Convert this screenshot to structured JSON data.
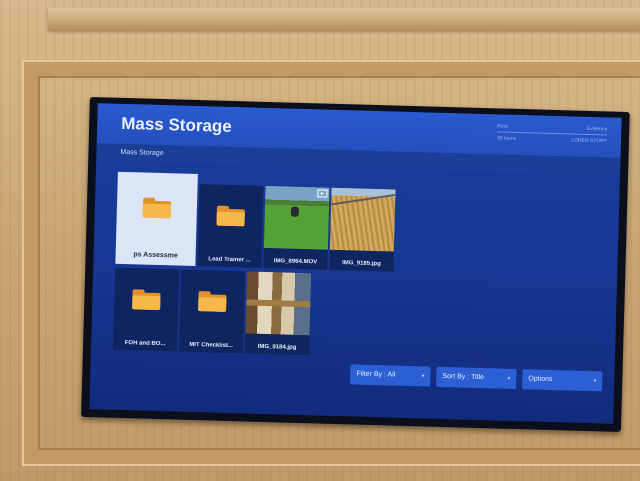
{
  "app": {
    "title": "Mass Storage",
    "breadcrumb": "Mass Storage",
    "header_info": {
      "left_top": "Root",
      "right_top": "Evidence",
      "left_bottom": "99 Items",
      "right_bottom": "LOREN STORY"
    }
  },
  "items": [
    {
      "label": "ps     Assessme",
      "type": "folder",
      "selected": true
    },
    {
      "label": "Lead Trainer ...",
      "type": "folder",
      "selected": false
    },
    {
      "label": "IMG_8964.MOV",
      "type": "video",
      "selected": false
    },
    {
      "label": "IMG_9185.jpg",
      "type": "image",
      "selected": false
    },
    {
      "label": "FOH and BO...",
      "type": "folder",
      "selected": false
    },
    {
      "label": "MIT Checklist...",
      "type": "folder",
      "selected": false
    },
    {
      "label": "IMG_9184.jpg",
      "type": "image",
      "selected": false
    }
  ],
  "toolbar": {
    "filter_label": "Filter By : All",
    "sort_label": "Sort By : Title",
    "options_label": "Options"
  },
  "icons": {
    "folder": "folder-icon",
    "caret": "chevron-down-icon"
  },
  "colors": {
    "titlebar": "#2654c4",
    "folder": "#f7b84a",
    "button": "#2c5fd4"
  }
}
